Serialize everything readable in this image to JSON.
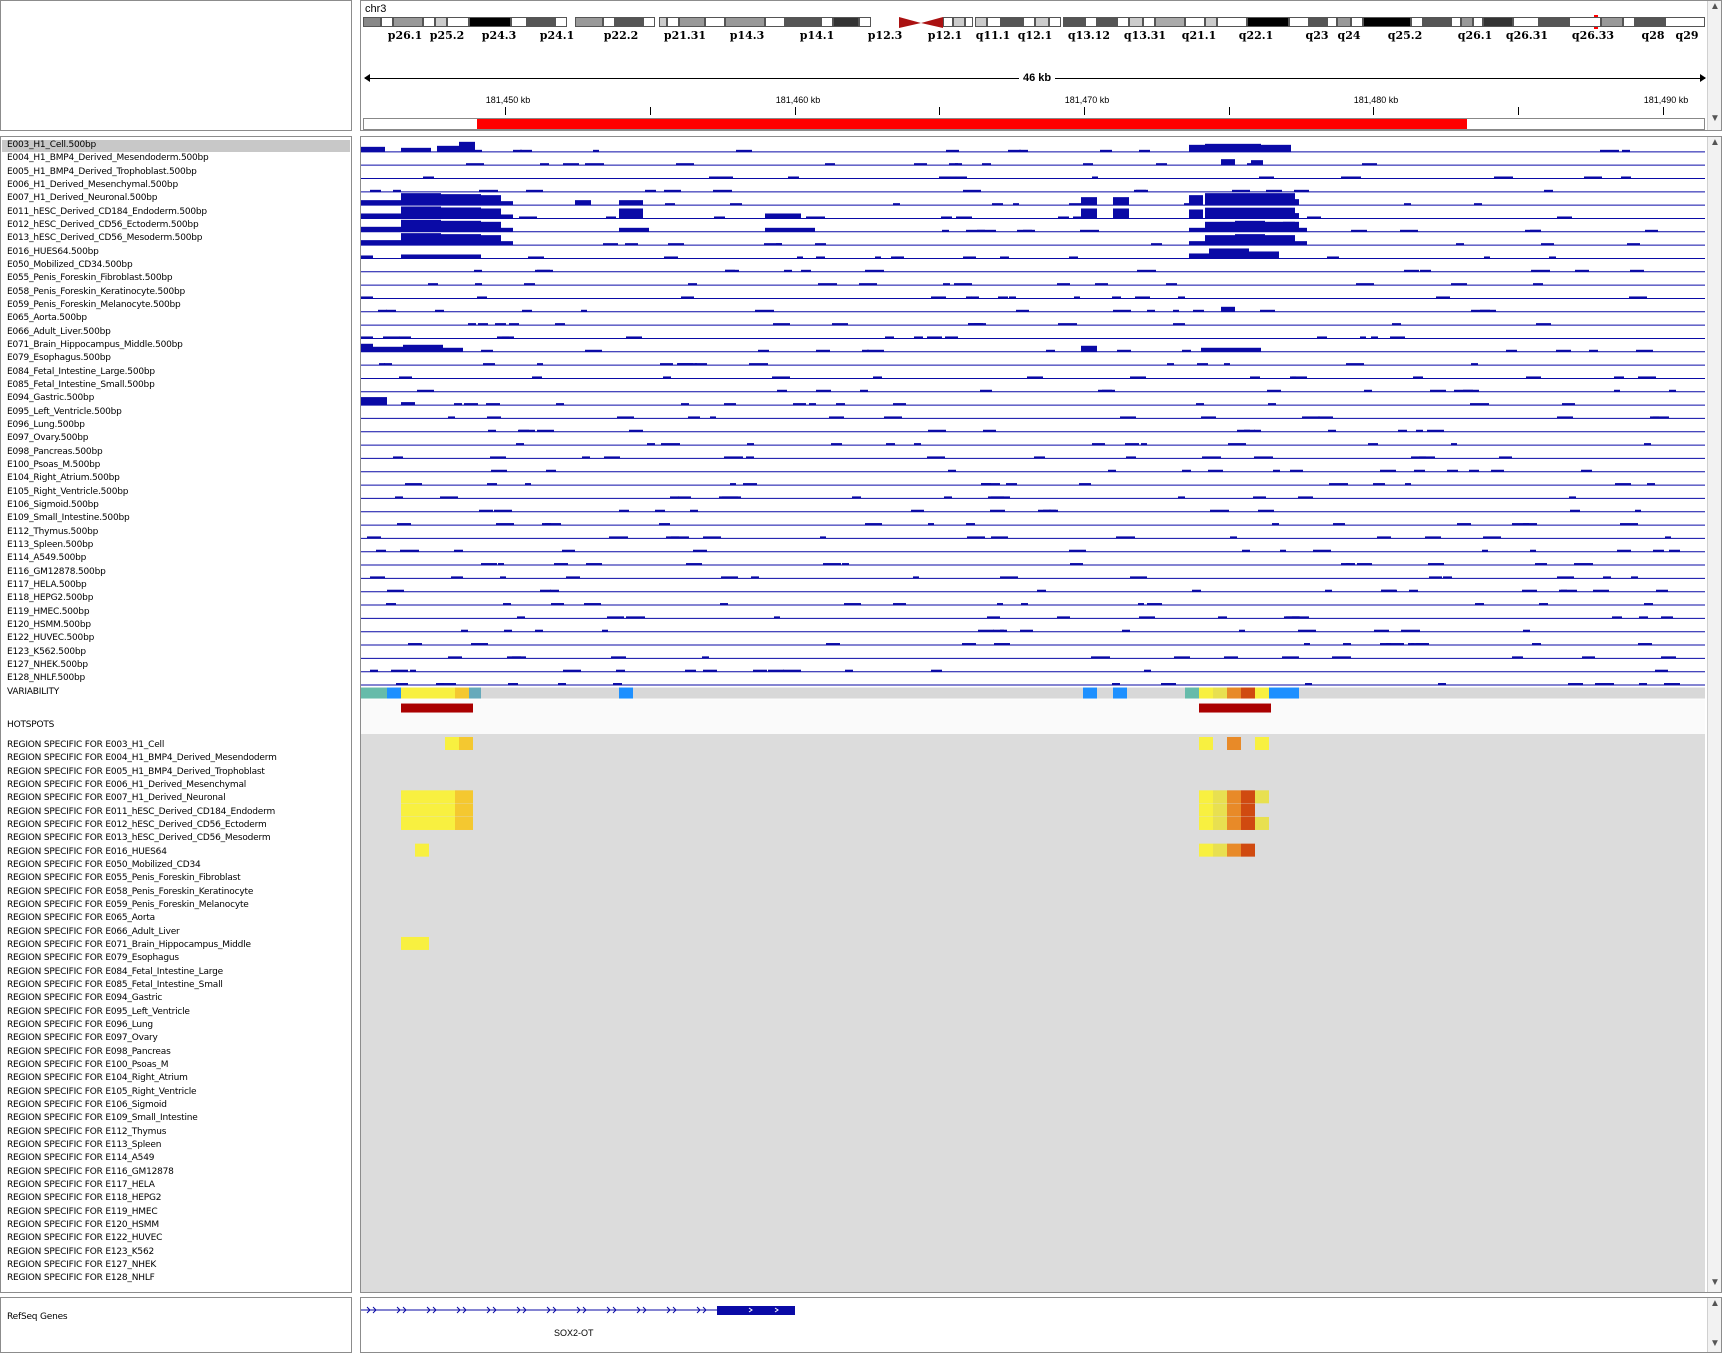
{
  "header": {
    "chromosome": "chr3",
    "region_width": "46 kb",
    "ruler_ticks": [
      "181,450 kb",
      "181,460 kb",
      "181,470 kb",
      "181,480 kb",
      "181,490 kb"
    ]
  },
  "ideogram_bands": [
    "p26.1",
    "p25.2",
    "p24.3",
    "p24.1",
    "p22.2",
    "p21.31",
    "p14.3",
    "p14.1",
    "p12.3",
    "p12.1",
    "q11.1",
    "q12.1",
    "q13.12",
    "q13.31",
    "q21.1",
    "q22.1",
    "q23",
    "q24",
    "q25.2",
    "q26.1",
    "q26.31",
    "q26.33",
    "q28",
    "q29"
  ],
  "signal_tracks": [
    "E003_H1_Cell.500bp",
    "E004_H1_BMP4_Derived_Mesendoderm.500bp",
    "E005_H1_BMP4_Derived_Trophoblast.500bp",
    "E006_H1_Derived_Mesenchymal.500bp",
    "E007_H1_Derived_Neuronal.500bp",
    "E011_hESC_Derived_CD184_Endoderm.500bp",
    "E012_hESC_Derived_CD56_Ectoderm.500bp",
    "E013_hESC_Derived_CD56_Mesoderm.500bp",
    "E016_HUES64.500bp",
    "E050_Mobilized_CD34.500bp",
    "E055_Penis_Foreskin_Fibroblast.500bp",
    "E058_Penis_Foreskin_Keratinocyte.500bp",
    "E059_Penis_Foreskin_Melanocyte.500bp",
    "E065_Aorta.500bp",
    "E066_Adult_Liver.500bp",
    "E071_Brain_Hippocampus_Middle.500bp",
    "E079_Esophagus.500bp",
    "E084_Fetal_Intestine_Large.500bp",
    "E085_Fetal_Intestine_Small.500bp",
    "E094_Gastric.500bp",
    "E095_Left_Ventricle.500bp",
    "E096_Lung.500bp",
    "E097_Ovary.500bp",
    "E098_Pancreas.500bp",
    "E100_Psoas_M.500bp",
    "E104_Right_Atrium.500bp",
    "E105_Right_Ventricle.500bp",
    "E106_Sigmoid.500bp",
    "E109_Small_Intestine.500bp",
    "E112_Thymus.500bp",
    "E113_Spleen.500bp",
    "E114_A549.500bp",
    "E116_GM12878.500bp",
    "E117_HELA.500bp",
    "E118_HEPG2.500bp",
    "E119_HMEC.500bp",
    "E120_HSMM.500bp",
    "E122_HUVEC.500bp",
    "E123_K562.500bp",
    "E127_NHEK.500bp",
    "E128_NHLF.500bp"
  ],
  "variability_label": "VARIABILITY",
  "hotspots_label": "HOTSPOTS",
  "region_tracks": [
    "REGION SPECIFIC FOR E003_H1_Cell",
    "REGION SPECIFIC FOR E004_H1_BMP4_Derived_Mesendoderm",
    "REGION SPECIFIC FOR E005_H1_BMP4_Derived_Trophoblast",
    "REGION SPECIFIC FOR E006_H1_Derived_Mesenchymal",
    "REGION SPECIFIC FOR E007_H1_Derived_Neuronal",
    "REGION SPECIFIC FOR E011_hESC_Derived_CD184_Endoderm",
    "REGION SPECIFIC FOR E012_hESC_Derived_CD56_Ectoderm",
    "REGION SPECIFIC FOR E013_hESC_Derived_CD56_Mesoderm",
    "REGION SPECIFIC FOR E016_HUES64",
    "REGION SPECIFIC FOR E050_Mobilized_CD34",
    "REGION SPECIFIC FOR E055_Penis_Foreskin_Fibroblast",
    "REGION SPECIFIC FOR E058_Penis_Foreskin_Keratinocyte",
    "REGION SPECIFIC FOR E059_Penis_Foreskin_Melanocyte",
    "REGION SPECIFIC FOR E065_Aorta",
    "REGION SPECIFIC FOR E066_Adult_Liver",
    "REGION SPECIFIC FOR E071_Brain_Hippocampus_Middle",
    "REGION SPECIFIC FOR E079_Esophagus",
    "REGION SPECIFIC FOR E084_Fetal_Intestine_Large",
    "REGION SPECIFIC FOR E085_Fetal_Intestine_Small",
    "REGION SPECIFIC FOR E094_Gastric",
    "REGION SPECIFIC FOR E095_Left_Ventricle",
    "REGION SPECIFIC FOR E096_Lung",
    "REGION SPECIFIC FOR E097_Ovary",
    "REGION SPECIFIC FOR E098_Pancreas",
    "REGION SPECIFIC FOR E100_Psoas_M",
    "REGION SPECIFIC FOR E104_Right_Atrium",
    "REGION SPECIFIC FOR E105_Right_Ventricle",
    "REGION SPECIFIC FOR E106_Sigmoid",
    "REGION SPECIFIC FOR E109_Small_Intestine",
    "REGION SPECIFIC FOR E112_Thymus",
    "REGION SPECIFIC FOR E113_Spleen",
    "REGION SPECIFIC FOR E114_A549",
    "REGION SPECIFIC FOR E116_GM12878",
    "REGION SPECIFIC FOR E117_HELA",
    "REGION SPECIFIC FOR E118_HEPG2",
    "REGION SPECIFIC FOR E119_HMEC",
    "REGION SPECIFIC FOR E120_HSMM",
    "REGION SPECIFIC FOR E122_HUVEC",
    "REGION SPECIFIC FOR E123_K562",
    "REGION SPECIFIC FOR E127_NHEK",
    "REGION SPECIFIC FOR E128_NHLF"
  ],
  "refseq": {
    "label": "RefSeq Genes",
    "gene_name": "SOX2-OT"
  },
  "colors": {
    "signal": "#0a0aa6",
    "highlight": "#ff0000",
    "hotspot": "#aa0000",
    "region_bg": "#dcdcdc",
    "heat_low": "#f8f040",
    "heat_mid": "#e88a28",
    "heat_high": "#d04a10",
    "variability_blue": "#1e90ff",
    "variability_teal": "#66bbaa"
  }
}
